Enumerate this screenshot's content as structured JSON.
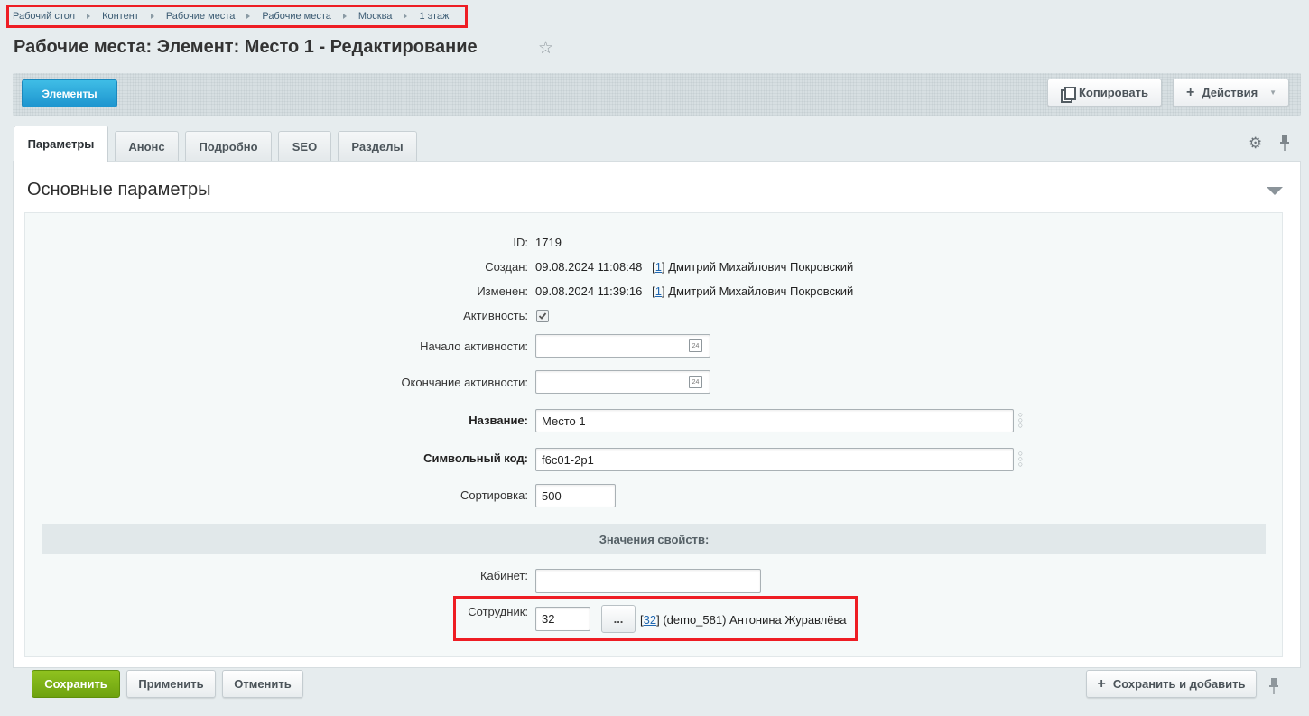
{
  "breadcrumbs": [
    "Рабочий стол",
    "Контент",
    "Рабочие места",
    "Рабочие места",
    "Москва",
    "1 этаж"
  ],
  "page_title": "Рабочие места: Элемент: Место 1 - Редактирование",
  "toolbar": {
    "elements_label": "Элементы",
    "copy_label": "Копировать",
    "actions_label": "Действия"
  },
  "tabs": [
    {
      "label": "Параметры",
      "active": true
    },
    {
      "label": "Анонс"
    },
    {
      "label": "Подробно"
    },
    {
      "label": "SEO"
    },
    {
      "label": "Разделы"
    }
  ],
  "section_title": "Основные параметры",
  "fields": {
    "id": {
      "label": "ID:",
      "value": "1719"
    },
    "created": {
      "label": "Создан:",
      "date": "09.08.2024 11:08:48",
      "user_id": "1",
      "user_name": "Дмитрий Михайлович Покровский"
    },
    "modified": {
      "label": "Изменен:",
      "date": "09.08.2024 11:39:16",
      "user_id": "1",
      "user_name": "Дмитрий Михайлович Покровский"
    },
    "active": {
      "label": "Активность:",
      "checked": true
    },
    "active_from": {
      "label": "Начало активности:",
      "value": "",
      "calendar_day": "24"
    },
    "active_to": {
      "label": "Окончание активности:",
      "value": "",
      "calendar_day": "24"
    },
    "name": {
      "label": "Название:",
      "value": "Место 1"
    },
    "code": {
      "label": "Символьный код:",
      "value": "f6c01-2p1"
    },
    "sort": {
      "label": "Сортировка:",
      "value": "500"
    }
  },
  "properties": {
    "header": "Значения свойств:",
    "cabinet": {
      "label": "Кабинет:",
      "value": ""
    },
    "employee": {
      "label": "Сотрудник:",
      "value": "32",
      "browse_label": "...",
      "link_id": "32",
      "description": "(demo_581) Антонина Журавлёва"
    }
  },
  "footer": {
    "save_label": "Сохранить",
    "apply_label": "Применить",
    "cancel_label": "Отменить",
    "save_add_label": "Сохранить и добавить"
  },
  "colors": {
    "accent_blue": "#1e95cf",
    "save_green": "#7ab317",
    "highlight_red": "#ee1d24"
  }
}
